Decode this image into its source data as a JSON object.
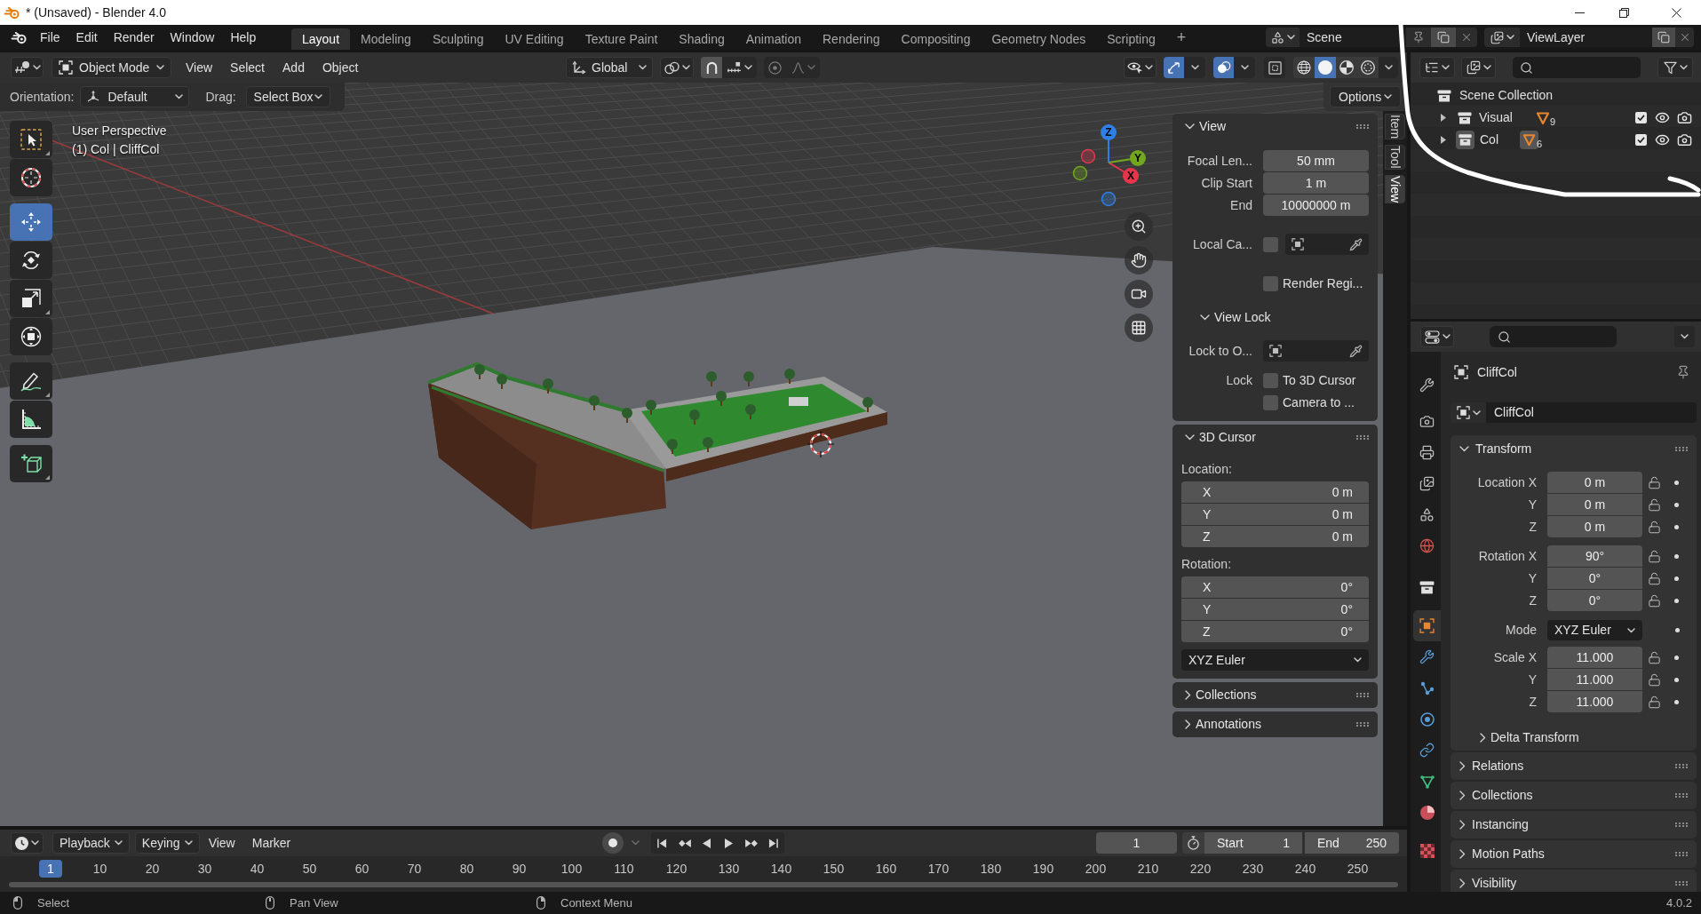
{
  "window": {
    "title": "* (Unsaved) - Blender 4.0"
  },
  "top_bar": {
    "menus": [
      "File",
      "Edit",
      "Render",
      "Window",
      "Help"
    ],
    "workspaces": [
      {
        "label": "Layout",
        "selected": true
      },
      {
        "label": "Modeling",
        "selected": false
      },
      {
        "label": "Sculpting",
        "selected": false
      },
      {
        "label": "UV Editing",
        "selected": false
      },
      {
        "label": "Texture Paint",
        "selected": false
      },
      {
        "label": "Shading",
        "selected": false
      },
      {
        "label": "Animation",
        "selected": false
      },
      {
        "label": "Rendering",
        "selected": false
      },
      {
        "label": "Compositing",
        "selected": false
      },
      {
        "label": "Geometry Nodes",
        "selected": false
      },
      {
        "label": "Scripting",
        "selected": false
      }
    ],
    "add_workspace": "+",
    "scene": "Scene",
    "view_layer": "ViewLayer"
  },
  "viewport_header": {
    "mode": "Object Mode",
    "menus": [
      "View",
      "Select",
      "Add",
      "Object"
    ],
    "orientation": "Global",
    "snap": true,
    "proportional_editing": false,
    "gizmos": true,
    "overlays": true,
    "xray": false,
    "shading": [
      {
        "kind": "wireframe",
        "selected": false
      },
      {
        "kind": "solid",
        "selected": true
      },
      {
        "kind": "material",
        "selected": false
      },
      {
        "kind": "rendered",
        "selected": false
      }
    ]
  },
  "tool_settings": {
    "orientation_label": "Orientation:",
    "orientation": "Default",
    "drag_label": "Drag:",
    "drag": "Select Box",
    "options": "Options"
  },
  "toolbar": {
    "groups": [
      {
        "tools": [
          {
            "kind": "select_box",
            "selected": false
          },
          {
            "kind": "cursor",
            "selected": false
          }
        ]
      },
      {
        "tools": [
          {
            "kind": "move",
            "selected": true
          },
          {
            "kind": "rotate",
            "selected": false
          },
          {
            "kind": "scale",
            "selected": false
          },
          {
            "kind": "transform",
            "selected": false
          }
        ]
      },
      {
        "tools": [
          {
            "kind": "annotate",
            "selected": false
          },
          {
            "kind": "measure",
            "selected": false
          }
        ]
      },
      {
        "tools": [
          {
            "kind": "add_cube",
            "selected": false
          }
        ]
      }
    ]
  },
  "viewport": {
    "view_name": "User Perspective",
    "context": "(1) Col | CliffCol",
    "gizmo_axes": [
      {
        "label": "X",
        "color": "#e5364b"
      },
      {
        "label": "Y",
        "color": "#70a71f"
      },
      {
        "label": "Z",
        "color": "#2e80e6"
      }
    ]
  },
  "sidebar": {
    "tabs": [
      {
        "label": "Item",
        "selected": false
      },
      {
        "label": "Tool",
        "selected": false
      },
      {
        "label": "View",
        "selected": true
      }
    ],
    "panels": [
      {
        "title": "View",
        "expanded": true,
        "rows": [
          {
            "kind": "field",
            "label": "Focal Len...",
            "value": "50 mm"
          },
          {
            "kind": "field",
            "label": "Clip Start",
            "value": "1 m"
          },
          {
            "kind": "field",
            "label": "End",
            "value": "10000000 m"
          },
          {
            "kind": "picker",
            "label": "Local Ca...",
            "checked": false
          },
          {
            "kind": "check",
            "label": "Render Regi...",
            "checked": false
          },
          {
            "kind": "subpanel",
            "title": "View Lock",
            "expanded": true
          },
          {
            "kind": "picker",
            "label": "Lock to O..."
          },
          {
            "kind": "check",
            "side_label": "Lock",
            "label": "To 3D Cursor",
            "checked": false
          },
          {
            "kind": "check",
            "label": "Camera to ...",
            "checked": false
          }
        ]
      },
      {
        "title": "3D Cursor",
        "expanded": true,
        "rows": [
          {
            "kind": "caption",
            "label": "Location:"
          },
          {
            "kind": "axis",
            "label": "X",
            "value": "0 m"
          },
          {
            "kind": "axis",
            "label": "Y",
            "value": "0 m"
          },
          {
            "kind": "axis",
            "label": "Z",
            "value": "0 m"
          },
          {
            "kind": "caption",
            "label": "Rotation:"
          },
          {
            "kind": "axis",
            "label": "X",
            "value": "0°"
          },
          {
            "kind": "axis",
            "label": "Y",
            "value": "0°"
          },
          {
            "kind": "axis",
            "label": "Z",
            "value": "0°"
          },
          {
            "kind": "dropdown",
            "value": "XYZ Euler"
          }
        ]
      },
      {
        "title": "Collections",
        "expanded": false
      },
      {
        "title": "Annotations",
        "expanded": false
      }
    ]
  },
  "outliner": {
    "tree": [
      {
        "name": "Scene Collection",
        "children": [
          {
            "name": "Visual",
            "count": "9",
            "expanded": false,
            "active": false,
            "checked": true,
            "visible": true,
            "renderable": true
          },
          {
            "name": "Col",
            "count": "6",
            "expanded": false,
            "active": true,
            "checked": true,
            "visible": true,
            "renderable": true
          }
        ]
      }
    ]
  },
  "properties": {
    "tab_groups": [
      {
        "tabs": [
          {
            "kind": "tool",
            "selected": false
          }
        ]
      },
      {
        "tabs": [
          {
            "kind": "render",
            "selected": false
          },
          {
            "kind": "output",
            "selected": false
          },
          {
            "kind": "view_layer",
            "selected": false
          },
          {
            "kind": "scene",
            "selected": false
          },
          {
            "kind": "world",
            "selected": false
          }
        ]
      },
      {
        "tabs": [
          {
            "kind": "collection",
            "selected": false
          }
        ]
      },
      {
        "tabs": [
          {
            "kind": "object",
            "selected": true
          },
          {
            "kind": "modifiers",
            "selected": false
          },
          {
            "kind": "particles",
            "selected": false
          },
          {
            "kind": "physics",
            "selected": false
          },
          {
            "kind": "constraints",
            "selected": false
          },
          {
            "kind": "data",
            "selected": false
          },
          {
            "kind": "material",
            "selected": false
          }
        ]
      },
      {
        "tabs": [
          {
            "kind": "texture",
            "selected": false
          }
        ]
      }
    ],
    "context": "CliffCol",
    "name": "CliffCol",
    "panels": [
      {
        "title": "Transform",
        "expanded": true,
        "groups": [
          {
            "kind": "fields",
            "rows": [
              {
                "label": "Location X",
                "value": "0 m",
                "locked": false
              },
              {
                "label": "Y",
                "value": "0 m",
                "locked": false
              },
              {
                "label": "Z",
                "value": "0 m",
                "locked": false
              }
            ]
          },
          {
            "kind": "fields",
            "rows": [
              {
                "label": "Rotation X",
                "value": "90°",
                "locked": false
              },
              {
                "label": "Y",
                "value": "0°",
                "locked": false
              },
              {
                "label": "Z",
                "value": "0°",
                "locked": false
              }
            ]
          },
          {
            "kind": "dropdown",
            "label": "Mode",
            "value": "XYZ Euler"
          },
          {
            "kind": "fields",
            "rows": [
              {
                "label": "Scale X",
                "value": "11.000",
                "locked": false
              },
              {
                "label": "Y",
                "value": "11.000",
                "locked": false
              },
              {
                "label": "Z",
                "value": "11.000",
                "locked": false
              }
            ]
          }
        ],
        "subpanels": [
          {
            "title": "Delta Transform",
            "expanded": false
          }
        ]
      },
      {
        "title": "Relations",
        "expanded": false
      },
      {
        "title": "Collections",
        "expanded": false
      },
      {
        "title": "Instancing",
        "expanded": false
      },
      {
        "title": "Motion Paths",
        "expanded": false
      },
      {
        "title": "Visibility",
        "expanded": false
      }
    ]
  },
  "timeline": {
    "menus": [
      {
        "label": "Playback",
        "dropdown": true
      },
      {
        "label": "Keying",
        "dropdown": true
      },
      {
        "label": "View",
        "dropdown": false
      },
      {
        "label": "Marker",
        "dropdown": false
      }
    ],
    "current_frame": "1",
    "start_label": "Start",
    "start": "1",
    "end_label": "End",
    "end": "250",
    "frames": [
      {
        "label": "1",
        "selected": true
      },
      {
        "label": "10",
        "selected": false
      },
      {
        "label": "20",
        "selected": false
      },
      {
        "label": "30",
        "selected": false
      },
      {
        "label": "40",
        "selected": false
      },
      {
        "label": "50",
        "selected": false
      },
      {
        "label": "60",
        "selected": false
      },
      {
        "label": "70",
        "selected": false
      },
      {
        "label": "80",
        "selected": false
      },
      {
        "label": "90",
        "selected": false
      },
      {
        "label": "100",
        "selected": false
      },
      {
        "label": "110",
        "selected": false
      },
      {
        "label": "120",
        "selected": false
      },
      {
        "label": "130",
        "selected": false
      },
      {
        "label": "140",
        "selected": false
      },
      {
        "label": "150",
        "selected": false
      },
      {
        "label": "160",
        "selected": false
      },
      {
        "label": "170",
        "selected": false
      },
      {
        "label": "180",
        "selected": false
      },
      {
        "label": "190",
        "selected": false
      },
      {
        "label": "200",
        "selected": false
      },
      {
        "label": "210",
        "selected": false
      },
      {
        "label": "220",
        "selected": false
      },
      {
        "label": "230",
        "selected": false
      },
      {
        "label": "240",
        "selected": false
      },
      {
        "label": "250",
        "selected": false
      }
    ]
  },
  "status_bar": {
    "hints": [
      {
        "kind": "left_click",
        "label": "Select"
      },
      {
        "kind": "middle_click",
        "label": "Pan View"
      },
      {
        "kind": "right_click",
        "label": "Context Menu"
      }
    ],
    "version": "4.0.2"
  }
}
